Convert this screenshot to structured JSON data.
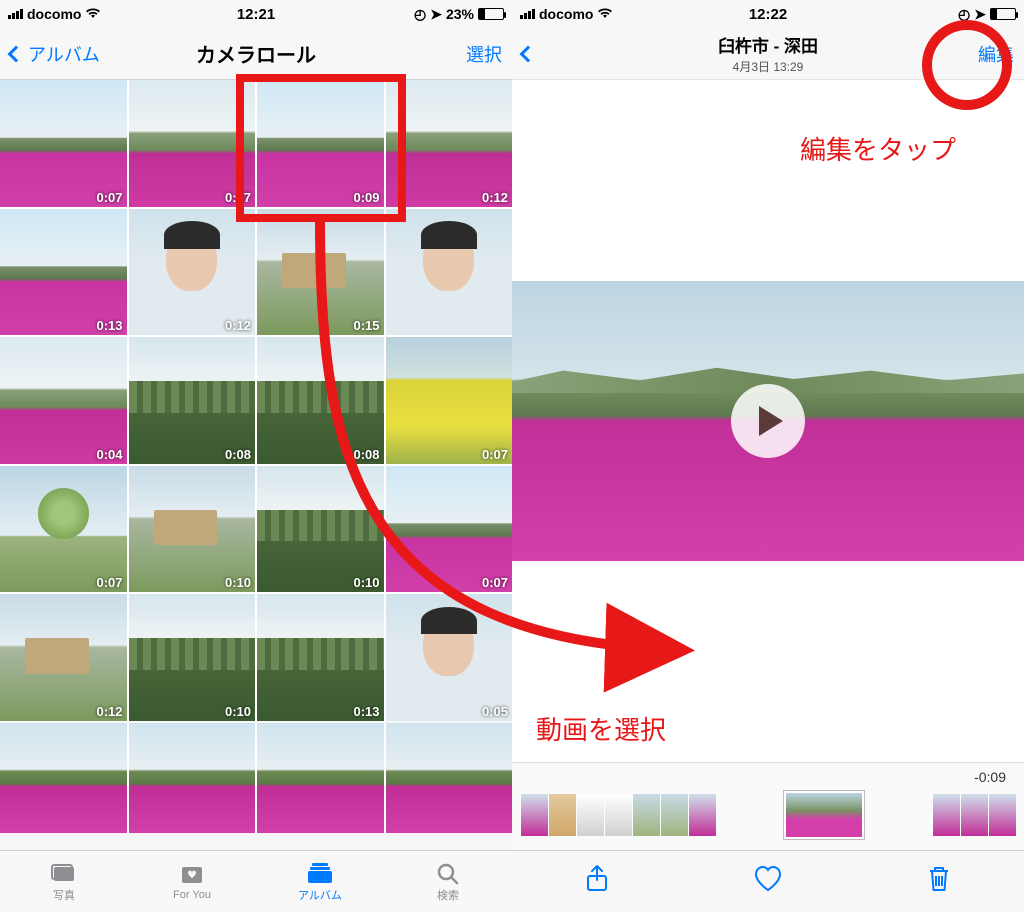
{
  "left": {
    "status": {
      "carrier": "docomo",
      "time": "12:21",
      "battery_pct": "23%"
    },
    "nav": {
      "back": "アルバム",
      "title": "カメラロール",
      "select": "選択"
    },
    "thumbs": [
      [
        "0:07",
        "0:07",
        "0:09",
        "0:12"
      ],
      [
        "0:13",
        "0:12",
        "0:15",
        ""
      ],
      [
        "0:04",
        "0:08",
        "0:08",
        "0:07"
      ],
      [
        "0:07",
        "0:10",
        "0:10",
        "0:07"
      ],
      [
        "0:12",
        "0:10",
        "0:13",
        "0:05"
      ]
    ],
    "tabs": {
      "photos": "写真",
      "foryou": "For You",
      "albums": "アルバム",
      "search": "検索"
    }
  },
  "right": {
    "status": {
      "carrier": "docomo",
      "time": "12:22"
    },
    "nav": {
      "title": "臼杵市 - 深田",
      "subtitle": "4月3日 13:29",
      "edit": "編集"
    },
    "scrub_time": "-0:09"
  },
  "annotations": {
    "tap_edit": "編集をタップ",
    "select_video": "動画を選択"
  }
}
